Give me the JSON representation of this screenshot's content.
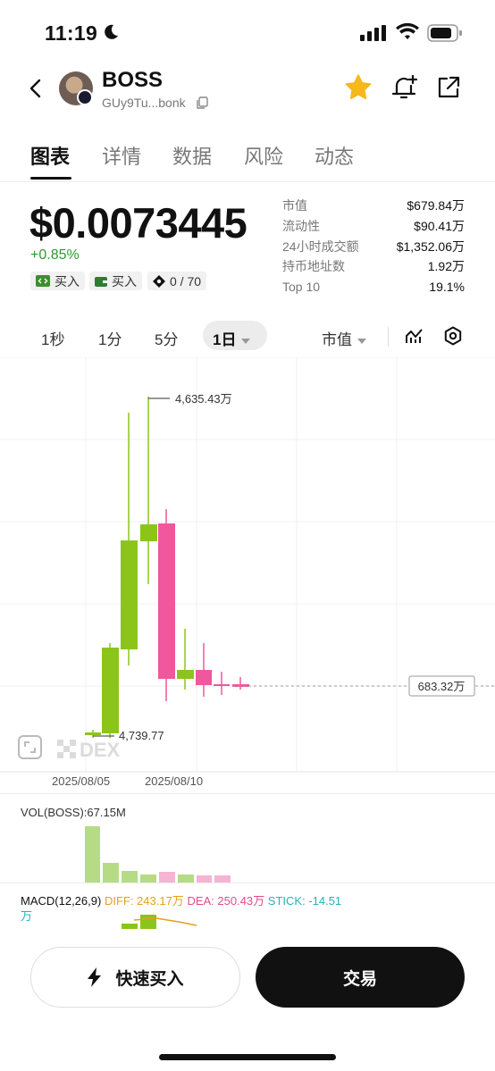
{
  "status": {
    "time": "11:19"
  },
  "token": {
    "name": "BOSS",
    "address": "GUy9Tu...bonk"
  },
  "tabs": [
    "图表",
    "详情",
    "数据",
    "风险",
    "动态"
  ],
  "price": {
    "value": "$0.0073445",
    "change": "+0.85%"
  },
  "chips": {
    "buy1": "买入",
    "buy2": "买入",
    "ratio": "0 / 70"
  },
  "stats": {
    "labels": [
      "市值",
      "流动性",
      "24小时成交额",
      "持币地址数",
      "Top 10"
    ],
    "values": [
      "$679.84万",
      "$90.41万",
      "$1,352.06万",
      "1.92万",
      "19.1%"
    ]
  },
  "intervals": {
    "items": [
      "1秒",
      "1分",
      "5分"
    ],
    "active": "1日",
    "metric": "市值"
  },
  "chart": {
    "high_label": "4,635.43万",
    "low_label": "4,739.77",
    "current_label": "683.32万",
    "watermark": "DEX",
    "dates": [
      "2025/08/05",
      "2025/08/10"
    ],
    "colors": {
      "up": "#8cc51a",
      "down": "#f0579c",
      "vol_up": "#b5dc84",
      "vol_down": "#f7b3d4"
    }
  },
  "indicators": {
    "vol": "VOL(BOSS):67.15M",
    "macd": "MACD(12,26,9)",
    "diff": "DIFF: 243.17万",
    "dea": "DEA: 250.43万",
    "stick": "STICK: -14.51",
    "stick_unit": "万"
  },
  "actions": {
    "quick_buy": "快速买入",
    "trade": "交易"
  }
}
